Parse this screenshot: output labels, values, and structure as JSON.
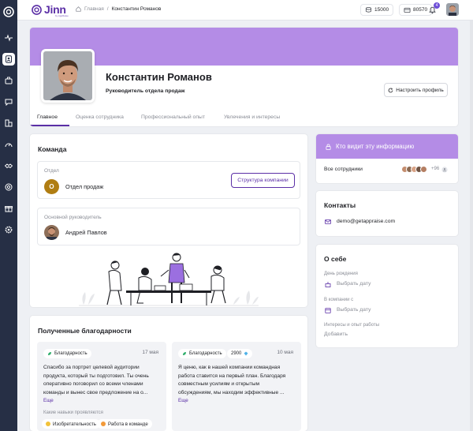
{
  "app": {
    "brand": "Jinn",
    "brand_sub": "by AppRaise"
  },
  "breadcrumbs": {
    "home": "Главная",
    "separator": "/",
    "current": "Константин Романов"
  },
  "header": {
    "coins": "15000",
    "wallet": "80570",
    "notifications_count": "4"
  },
  "profile": {
    "name": "Константин Романов",
    "role": "Руководитель отдела продаж",
    "settings_button": "Настроить профиль",
    "tabs": [
      "Главное",
      "Оценка сотрудника",
      "Профессиональный опыт",
      "Увлечения и интересы"
    ],
    "active_tab": 0
  },
  "team": {
    "title": "Команда",
    "dept_label": "Отдел",
    "dept_initial": "О",
    "dept_name": "Отдел продаж",
    "structure_button": "Структура компании",
    "manager_label": "Основной руководитель",
    "manager_name": "Андрей Павлов"
  },
  "visibility": {
    "title": "Кто видит эту информацию",
    "audience": "Все сотрудники",
    "extra_count": "+96"
  },
  "contacts": {
    "title": "Контакты",
    "email": "demo@getappraise.com"
  },
  "about": {
    "title": "О себе",
    "birthday_label": "День рождения",
    "birthday_action": "Выбрать дату",
    "company_label": "В компании с",
    "company_action": "Выбрать дату",
    "interests_label": "Интересы и опыт работы",
    "interests_action": "Добавить"
  },
  "thanks": {
    "title": "Полученные благодарности",
    "items": [
      {
        "tag": "Благодарность",
        "date": "17 мая",
        "text": "Спасибо за портрет целевой аудитории продукта, который ты подготовил. Ты очень оперативно поговорил со всеми членами команды и вынес свое предложение на о...",
        "more": "Еще",
        "skills_title": "Какие навыки проявляются",
        "skills": [
          "Изобретательность",
          "Работа в команде"
        ]
      },
      {
        "tag": "Благодарность",
        "points": "2900",
        "date": "10 мая",
        "text": "Я ценю, как в нашей компании командная работа ставится на первый план. Благодаря совместным усилиям и открытым обсуждениям, мы находим эффективные ...",
        "more": "Еще"
      }
    ]
  },
  "colors": {
    "accent": "#5b2fa6",
    "cover": "#b48ce6",
    "rail": "#262f45",
    "dept": "#b07d12"
  }
}
